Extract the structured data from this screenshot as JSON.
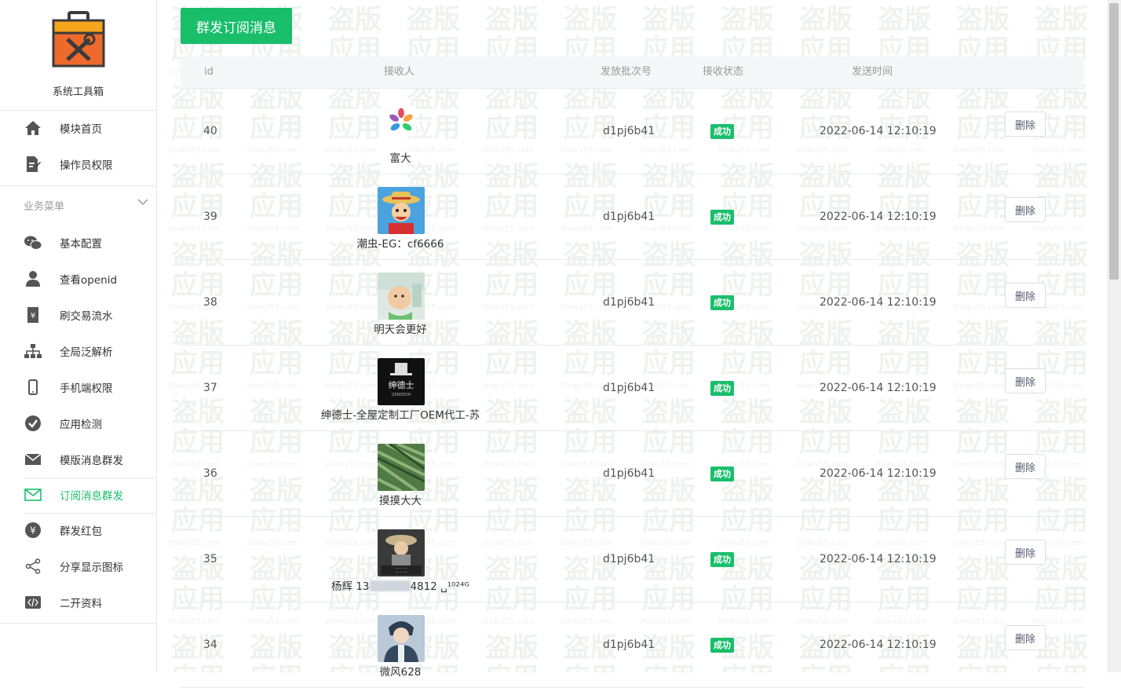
{
  "sidebar": {
    "brand_title": "系统工具箱",
    "top_items": [
      {
        "label": "模块首页",
        "icon": "home-icon"
      },
      {
        "label": "操作员权限",
        "icon": "document-edit-icon"
      }
    ],
    "group_title": "业务菜单",
    "items": [
      {
        "label": "基本配置",
        "icon": "wechat-icon"
      },
      {
        "label": "查看openid",
        "icon": "user-icon"
      },
      {
        "label": "刷交易流水",
        "icon": "money-doc-icon"
      },
      {
        "label": "全局泛解析",
        "icon": "sitemap-icon"
      },
      {
        "label": "手机端权限",
        "icon": "mobile-icon"
      },
      {
        "label": "应用检测",
        "icon": "check-circle-icon"
      },
      {
        "label": "模版消息群发",
        "icon": "mail-icon"
      },
      {
        "label": "订阅消息群发",
        "icon": "mail-outline-icon",
        "active": true
      },
      {
        "label": "群发红包",
        "icon": "yen-coin-icon"
      },
      {
        "label": "分享显示图标",
        "icon": "share-icon"
      },
      {
        "label": "二开资料",
        "icon": "code-icon"
      }
    ]
  },
  "main": {
    "send_button": "群发订阅消息",
    "table": {
      "headers": [
        "id",
        "接收人",
        "发放批次号",
        "接收状态",
        "发送时间"
      ],
      "delete_label": "删除",
      "rows": [
        {
          "id": "40",
          "name": "富大",
          "batch": "d1pj6b41",
          "status": "成功",
          "time": "2022-06-14 12:10:19",
          "avatar": "colorful-flower"
        },
        {
          "id": "39",
          "name": "潮虫-EG：cf6666",
          "batch": "d1pj6b41",
          "status": "成功",
          "time": "2022-06-14 12:10:19",
          "avatar": "cartoon-straw-hat"
        },
        {
          "id": "38",
          "name": "明天会更好",
          "batch": "d1pj6b41",
          "status": "成功",
          "time": "2022-06-14 12:10:19",
          "avatar": "baby-photo"
        },
        {
          "id": "37",
          "name": "绅德士-全屋定制工厂OEM代工-苏",
          "batch": "d1pj6b41",
          "status": "成功",
          "time": "2022-06-14 12:10:19",
          "avatar": "gentleman-logo"
        },
        {
          "id": "36",
          "name": "摸摸大大",
          "batch": "d1pj6b41",
          "status": "成功",
          "time": "2022-06-14 12:10:19",
          "avatar": "green-leaves"
        },
        {
          "id": "35",
          "name": "杨辉 13",
          "name_tail": "4812 ␣¹⁰²⁴ᴳ",
          "batch": "d1pj6b41",
          "status": "成功",
          "time": "2022-06-14 12:10:19",
          "avatar": "monk-photo"
        },
        {
          "id": "34",
          "name": "微风628",
          "batch": "d1pj6b41",
          "status": "成功",
          "time": "2022-06-14 12:10:19",
          "avatar": "anime-boy"
        }
      ]
    }
  },
  "colors": {
    "accent": "#19be6b",
    "border": "#e8eaec",
    "header_bg": "#f5f7f9"
  }
}
